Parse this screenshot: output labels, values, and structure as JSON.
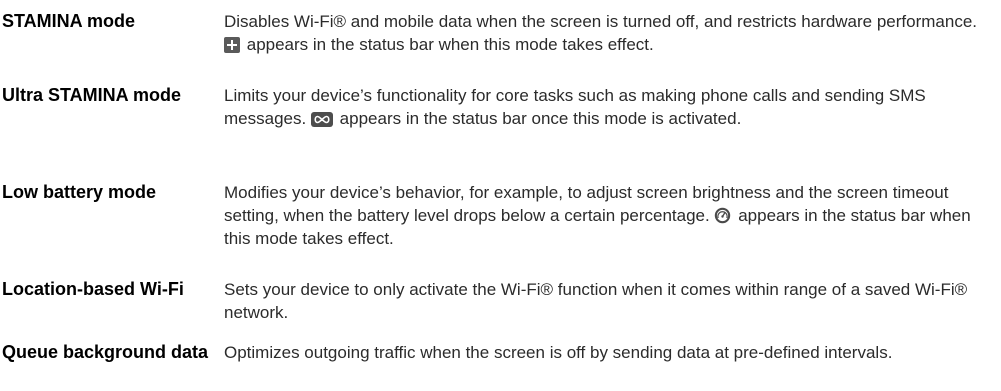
{
  "rows": [
    {
      "term": "STAMINA mode",
      "desc_before": "Disables Wi-Fi® and mobile data when the screen is turned off, and restricts hardware performance.",
      "icon": "stamina-plus-icon",
      "desc_after": "appears in the status bar when this mode takes effect."
    },
    {
      "term": "Ultra STAMINA mode",
      "desc_before": "Limits your device’s functionality for core tasks such as making phone calls and sending SMS messages.",
      "icon": "ultra-stamina-infinity-icon",
      "desc_after": "appears in the status bar once this mode is activated."
    },
    {
      "term": "Low battery mode",
      "desc_before": "Modifies your device’s behavior, for example, to adjust screen brightness and the screen timeout setting, when the battery level drops below a certain percentage.",
      "icon": "low-battery-gauge-icon",
      "desc_after": "appears in the status bar when this mode takes effect."
    },
    {
      "term": "Location-based Wi-Fi",
      "desc": "Sets your device to only activate the Wi-Fi® function when it comes within range of a saved Wi-Fi® network."
    },
    {
      "term": "Queue background data",
      "desc": "Optimizes outgoing traffic when the screen is off by sending data at pre-defined intervals."
    }
  ]
}
